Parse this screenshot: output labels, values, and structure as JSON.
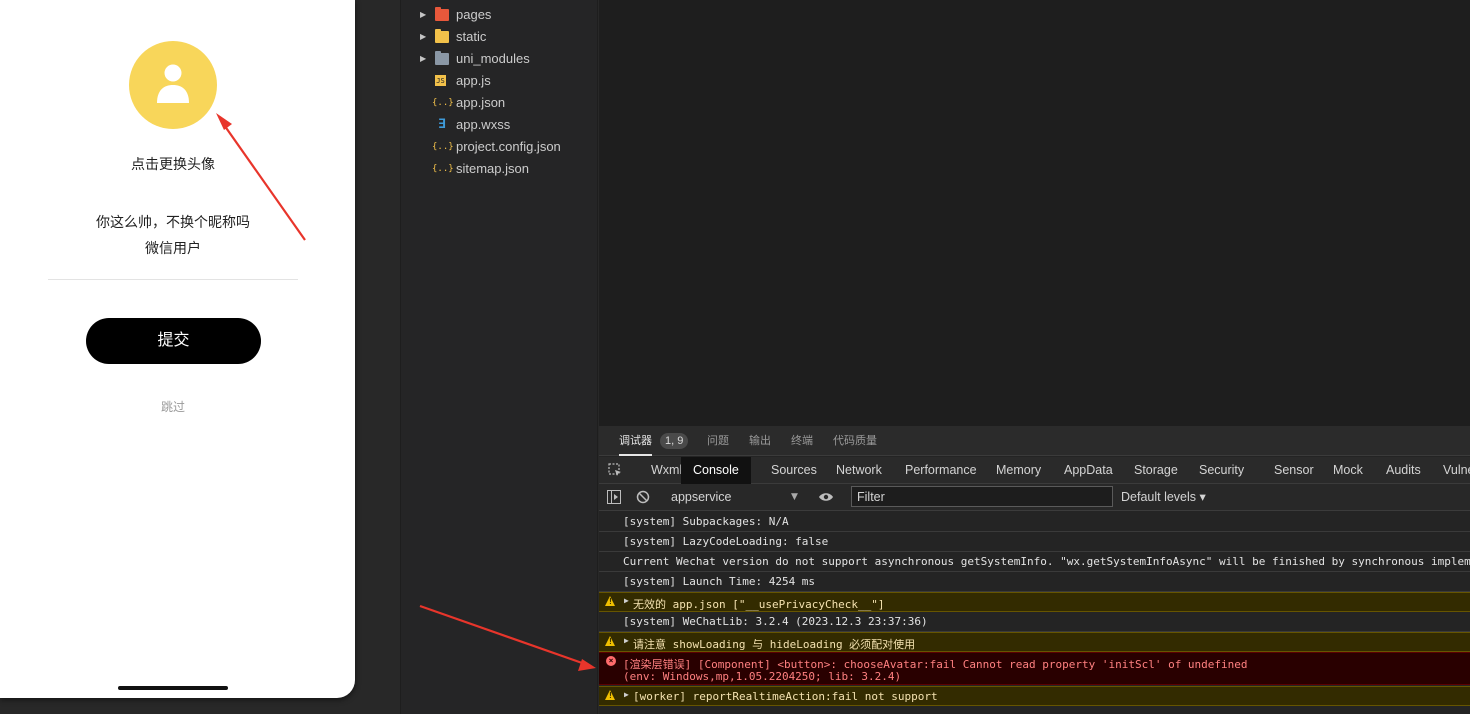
{
  "simulator": {
    "change_avatar": "点击更换头像",
    "nickname_prompt": "你这么帅，不换个昵称吗",
    "nickname_value": "微信用户",
    "submit_label": "提交",
    "skip_label": "跳过"
  },
  "explorer": {
    "items": [
      {
        "label": "pages",
        "icon": "folder-pages-icon",
        "color": "#e8583b",
        "expandable": true
      },
      {
        "label": "static",
        "icon": "folder-icon",
        "color": "#f2c14a",
        "expandable": true
      },
      {
        "label": "uni_modules",
        "icon": "folder-icon",
        "color": "#8a97a5",
        "expandable": true
      },
      {
        "label": "app.js",
        "icon": "js-file-icon",
        "color": "#f2c14a",
        "expandable": false
      },
      {
        "label": "app.json",
        "icon": "json-file-icon",
        "color": "#f2c14a",
        "expandable": false
      },
      {
        "label": "app.wxss",
        "icon": "css-file-icon",
        "color": "#3e9ad8",
        "expandable": false
      },
      {
        "label": "project.config.json",
        "icon": "json-file-icon",
        "color": "#f2c14a",
        "expandable": false
      },
      {
        "label": "sitemap.json",
        "icon": "json-file-icon",
        "color": "#f2c14a",
        "expandable": false
      }
    ]
  },
  "devtools": {
    "top_tabs": {
      "debugger": "调试器",
      "badge": "1, 9",
      "issues": "问题",
      "output": "输出",
      "terminal": "终端",
      "quality": "代码质量"
    },
    "tabs": [
      "Wxml",
      "Console",
      "Sources",
      "Network",
      "Performance",
      "Memory",
      "AppData",
      "Storage",
      "Security",
      "Sensor",
      "Mock",
      "Audits",
      "Vulne"
    ],
    "active_tab": "Console",
    "context": "appservice",
    "filter_placeholder": "Filter",
    "levels": "Default levels ▾",
    "console": [
      {
        "level": "log",
        "text": "[system] Subpackages: N/A"
      },
      {
        "level": "log",
        "text": "[system] LazyCodeLoading: false"
      },
      {
        "level": "log",
        "text": "Current Wechat version do not support asynchronous getSystemInfo. \"wx.getSystemInfoAsync\" will be finished by synchronous impleme"
      },
      {
        "level": "log",
        "text": "[system] Launch Time: 4254 ms"
      },
      {
        "level": "warn",
        "text": "无效的 app.json [\"__usePrivacyCheck__\"]"
      },
      {
        "level": "log",
        "text": "[system] WeChatLib: 3.2.4 (2023.12.3 23:37:36)"
      },
      {
        "level": "warn",
        "text": "请注意 showLoading 与 hideLoading 必须配对使用"
      },
      {
        "level": "error",
        "text": "[渲染层错误] [Component] <button>: chooseAvatar:fail Cannot read property 'initScl' of undefined",
        "text2": "(env: Windows,mp,1.05.2204250; lib: 3.2.4)"
      },
      {
        "level": "warn",
        "text": "[worker] reportRealtimeAction:fail not support"
      }
    ]
  },
  "colors": {
    "avatar": "#f8d65a",
    "arrow": "#e8352b",
    "submit_bg": "#000000"
  }
}
